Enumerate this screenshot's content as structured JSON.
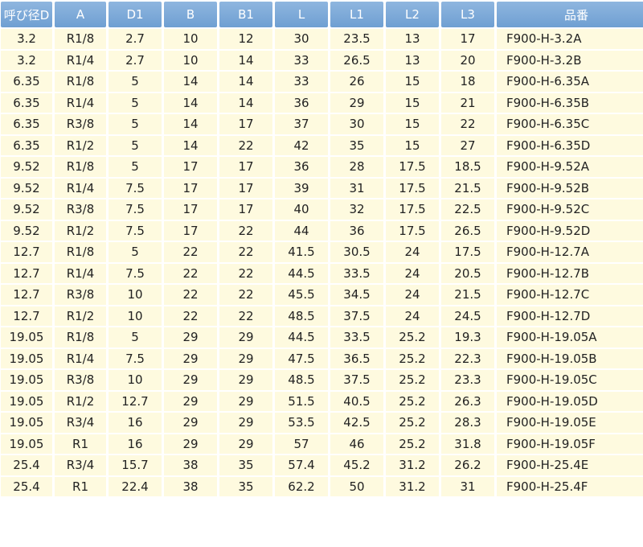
{
  "table": {
    "headers": [
      "呼び径D",
      "A",
      "D1",
      "B",
      "B1",
      "L",
      "L1",
      "L2",
      "L3",
      "品番"
    ],
    "rows": [
      [
        "3.2",
        "R1/8",
        "2.7",
        "10",
        "12",
        "30",
        "23.5",
        "13",
        "17",
        "F900-H-3.2A"
      ],
      [
        "3.2",
        "R1/4",
        "2.7",
        "10",
        "14",
        "33",
        "26.5",
        "13",
        "20",
        "F900-H-3.2B"
      ],
      [
        "6.35",
        "R1/8",
        "5",
        "14",
        "14",
        "33",
        "26",
        "15",
        "18",
        "F900-H-6.35A"
      ],
      [
        "6.35",
        "R1/4",
        "5",
        "14",
        "14",
        "36",
        "29",
        "15",
        "21",
        "F900-H-6.35B"
      ],
      [
        "6.35",
        "R3/8",
        "5",
        "14",
        "17",
        "37",
        "30",
        "15",
        "22",
        "F900-H-6.35C"
      ],
      [
        "6.35",
        "R1/2",
        "5",
        "14",
        "22",
        "42",
        "35",
        "15",
        "27",
        "F900-H-6.35D"
      ],
      [
        "9.52",
        "R1/8",
        "5",
        "17",
        "17",
        "36",
        "28",
        "17.5",
        "18.5",
        "F900-H-9.52A"
      ],
      [
        "9.52",
        "R1/4",
        "7.5",
        "17",
        "17",
        "39",
        "31",
        "17.5",
        "21.5",
        "F900-H-9.52B"
      ],
      [
        "9.52",
        "R3/8",
        "7.5",
        "17",
        "17",
        "40",
        "32",
        "17.5",
        "22.5",
        "F900-H-9.52C"
      ],
      [
        "9.52",
        "R1/2",
        "7.5",
        "17",
        "22",
        "44",
        "36",
        "17.5",
        "26.5",
        "F900-H-9.52D"
      ],
      [
        "12.7",
        "R1/8",
        "5",
        "22",
        "22",
        "41.5",
        "30.5",
        "24",
        "17.5",
        "F900-H-12.7A"
      ],
      [
        "12.7",
        "R1/4",
        "7.5",
        "22",
        "22",
        "44.5",
        "33.5",
        "24",
        "20.5",
        "F900-H-12.7B"
      ],
      [
        "12.7",
        "R3/8",
        "10",
        "22",
        "22",
        "45.5",
        "34.5",
        "24",
        "21.5",
        "F900-H-12.7C"
      ],
      [
        "12.7",
        "R1/2",
        "10",
        "22",
        "22",
        "48.5",
        "37.5",
        "24",
        "24.5",
        "F900-H-12.7D"
      ],
      [
        "19.05",
        "R1/8",
        "5",
        "29",
        "29",
        "44.5",
        "33.5",
        "25.2",
        "19.3",
        "F900-H-19.05A"
      ],
      [
        "19.05",
        "R1/4",
        "7.5",
        "29",
        "29",
        "47.5",
        "36.5",
        "25.2",
        "22.3",
        "F900-H-19.05B"
      ],
      [
        "19.05",
        "R3/8",
        "10",
        "29",
        "29",
        "48.5",
        "37.5",
        "25.2",
        "23.3",
        "F900-H-19.05C"
      ],
      [
        "19.05",
        "R1/2",
        "12.7",
        "29",
        "29",
        "51.5",
        "40.5",
        "25.2",
        "26.3",
        "F900-H-19.05D"
      ],
      [
        "19.05",
        "R3/4",
        "16",
        "29",
        "29",
        "53.5",
        "42.5",
        "25.2",
        "28.3",
        "F900-H-19.05E"
      ],
      [
        "19.05",
        "R1",
        "16",
        "29",
        "29",
        "57",
        "46",
        "25.2",
        "31.8",
        "F900-H-19.05F"
      ],
      [
        "25.4",
        "R3/4",
        "15.7",
        "38",
        "35",
        "57.4",
        "45.2",
        "31.2",
        "26.2",
        "F900-H-25.4E"
      ],
      [
        "25.4",
        "R1",
        "22.4",
        "38",
        "35",
        "62.2",
        "50",
        "31.2",
        "31",
        "F900-H-25.4F"
      ]
    ]
  },
  "colors": {
    "header_bg": "#7ea9d8",
    "cell_bg": "#fefadf",
    "rule": "#7aa4d5"
  }
}
